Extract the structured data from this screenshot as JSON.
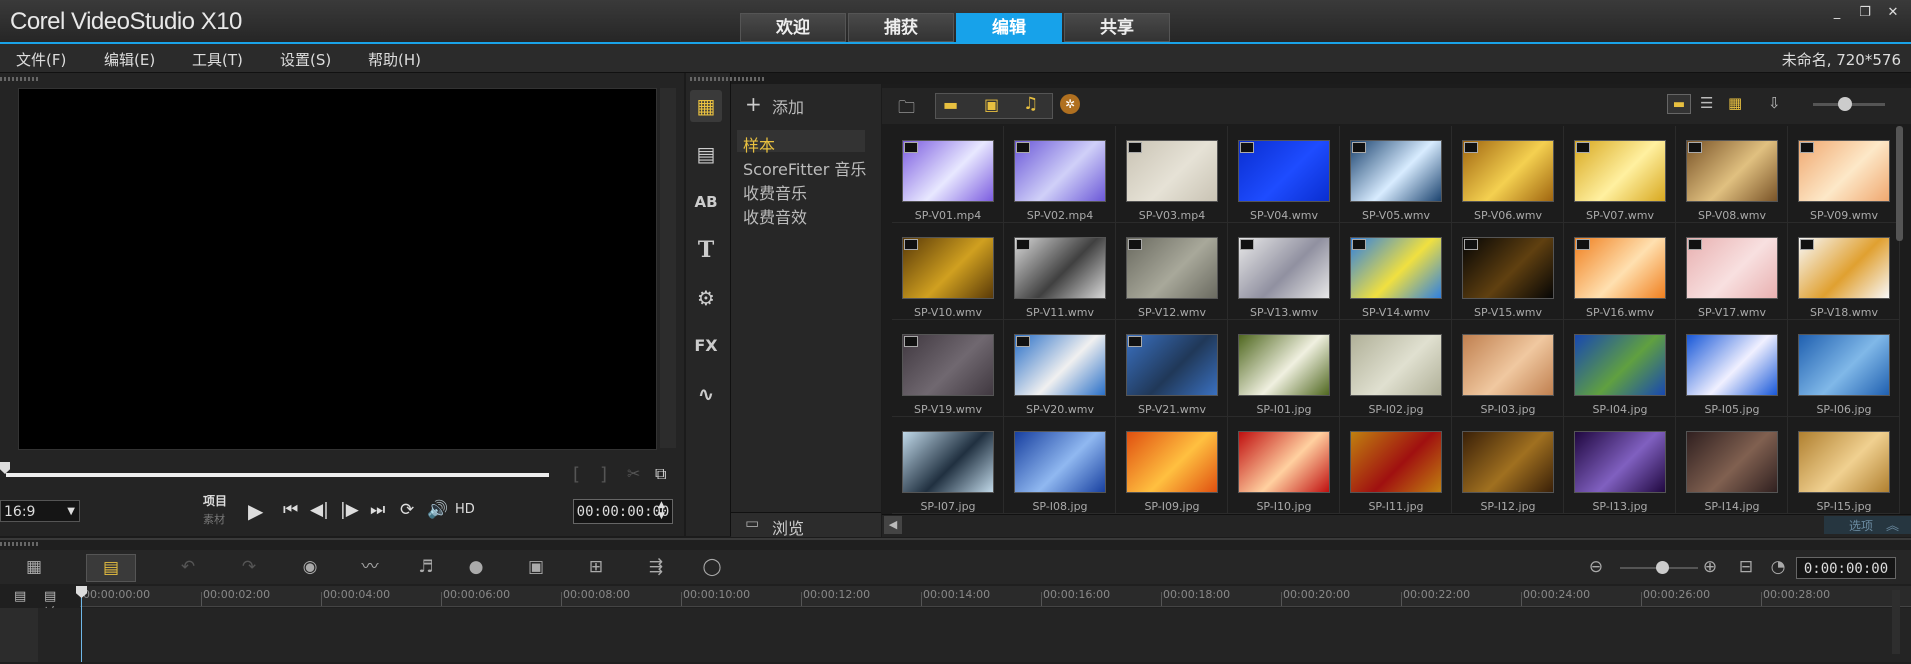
{
  "app": {
    "logo_text": "Corel VideoStudio X10"
  },
  "window_buttons": [
    "_",
    "❐",
    "✕"
  ],
  "tabs": [
    {
      "label": "欢迎",
      "active": false
    },
    {
      "label": "捕获",
      "active": false
    },
    {
      "label": "编辑",
      "active": true
    },
    {
      "label": "共享",
      "active": false
    }
  ],
  "menu": [
    "文件(F)",
    "编辑(E)",
    "工具(T)",
    "设置(S)",
    "帮助(H)"
  ],
  "project_info": "未命名, 720*576",
  "player": {
    "aspect_ratio": "16:9",
    "mode_project": "项目",
    "mode_clip": "素材",
    "hd_label": "HD",
    "timecode": "00:00:00:00"
  },
  "library": {
    "add_label": "添加",
    "categories": [
      {
        "label": "样本",
        "selected": true
      },
      {
        "label": "ScoreFitter 音乐",
        "selected": false
      },
      {
        "label": "收费音乐",
        "selected": false
      },
      {
        "label": "收费音效",
        "selected": false
      }
    ],
    "browse_label": "浏览",
    "options_label": "选项",
    "clips": [
      {
        "name": "SP-V01.mp4",
        "video": true,
        "c1": "#7c5de0",
        "c2": "#e8e8ff"
      },
      {
        "name": "SP-V02.mp4",
        "video": true,
        "c1": "#6b58d8",
        "c2": "#d0d0f8"
      },
      {
        "name": "SP-V03.mp4",
        "video": true,
        "c1": "#c9c3b4",
        "c2": "#e6e2d6"
      },
      {
        "name": "SP-V04.wmv",
        "video": true,
        "c1": "#0a2ed0",
        "c2": "#1e4cff"
      },
      {
        "name": "SP-V05.wmv",
        "video": true,
        "c1": "#1c4470",
        "c2": "#d8ecff"
      },
      {
        "name": "SP-V06.wmv",
        "video": true,
        "c1": "#a06610",
        "c2": "#f4d050"
      },
      {
        "name": "SP-V07.wmv",
        "video": true,
        "c1": "#d8a820",
        "c2": "#fff0a0"
      },
      {
        "name": "SP-V08.wmv",
        "video": true,
        "c1": "#7a5428",
        "c2": "#e0c080"
      },
      {
        "name": "SP-V09.wmv",
        "video": true,
        "c1": "#f0a870",
        "c2": "#fde8c8"
      },
      {
        "name": "SP-V10.wmv",
        "video": true,
        "c1": "#5a3a08",
        "c2": "#d0a020"
      },
      {
        "name": "SP-V11.wmv",
        "video": true,
        "c1": "#d8d8d8",
        "c2": "#404040"
      },
      {
        "name": "SP-V12.wmv",
        "video": true,
        "c1": "#6a6a60",
        "c2": "#a8a89a"
      },
      {
        "name": "SP-V13.wmv",
        "video": true,
        "c1": "#e8e8e8",
        "c2": "#9090a0"
      },
      {
        "name": "SP-V14.wmv",
        "video": true,
        "c1": "#3080e0",
        "c2": "#f0e040"
      },
      {
        "name": "SP-V15.wmv",
        "video": true,
        "c1": "#050505",
        "c2": "#604010"
      },
      {
        "name": "SP-V16.wmv",
        "video": true,
        "c1": "#f08020",
        "c2": "#ffe0b0"
      },
      {
        "name": "SP-V17.wmv",
        "video": true,
        "c1": "#e8b0b0",
        "c2": "#f8e0e0"
      },
      {
        "name": "SP-V18.wmv",
        "video": true,
        "c1": "#f8f8f8",
        "c2": "#e0a030"
      },
      {
        "name": "SP-V19.wmv",
        "video": true,
        "c1": "#403840",
        "c2": "#706870"
      },
      {
        "name": "SP-V20.wmv",
        "video": true,
        "c1": "#2a70c8",
        "c2": "#f0f0f0"
      },
      {
        "name": "SP-V21.wmv",
        "video": true,
        "c1": "#3a70c0",
        "c2": "#203858"
      },
      {
        "name": "SP-I01.jpg",
        "video": false,
        "c1": "#506820",
        "c2": "#f0f0e0"
      },
      {
        "name": "SP-I02.jpg",
        "video": false,
        "c1": "#b0b098",
        "c2": "#e0e0d0"
      },
      {
        "name": "SP-I03.jpg",
        "video": false,
        "c1": "#c08050",
        "c2": "#f0c8a0"
      },
      {
        "name": "SP-I04.jpg",
        "video": false,
        "c1": "#1848b0",
        "c2": "#60a040"
      },
      {
        "name": "SP-I05.jpg",
        "video": false,
        "c1": "#1858d8",
        "c2": "#f0f0ff"
      },
      {
        "name": "SP-I06.jpg",
        "video": false,
        "c1": "#2060b0",
        "c2": "#80b8e8"
      },
      {
        "name": "SP-I07.jpg",
        "video": false,
        "c1": "#c0d8e8",
        "c2": "#203040"
      },
      {
        "name": "SP-I08.jpg",
        "video": false,
        "c1": "#1840a0",
        "c2": "#90b8f0"
      },
      {
        "name": "SP-I09.jpg",
        "video": false,
        "c1": "#e05010",
        "c2": "#ffc040"
      },
      {
        "name": "SP-I10.jpg",
        "video": false,
        "c1": "#c01010",
        "c2": "#ffd0a0"
      },
      {
        "name": "SP-I11.jpg",
        "video": false,
        "c1": "#c08010",
        "c2": "#a01010"
      },
      {
        "name": "SP-I12.jpg",
        "video": false,
        "c1": "#3a2008",
        "c2": "#a07020"
      },
      {
        "name": "SP-I13.jpg",
        "video": false,
        "c1": "#200840",
        "c2": "#8060c0"
      },
      {
        "name": "SP-I14.jpg",
        "video": false,
        "c1": "#302020",
        "c2": "#806050"
      },
      {
        "name": "SP-I15.jpg",
        "video": false,
        "c1": "#b08030",
        "c2": "#f0d090"
      }
    ]
  },
  "timeline": {
    "timecode": "0:00:00:00",
    "ruler": [
      "00:00:00:00",
      "00:00:02:00",
      "00:00:04:00",
      "00:00:06:00",
      "00:00:08:00",
      "00:00:10:00",
      "00:00:12:00",
      "00:00:14:00",
      "00:00:16:00",
      "00:00:18:00",
      "00:00:20:00",
      "00:00:22:00",
      "00:00:24:00",
      "00:00:26:00",
      "00:00:28:00"
    ],
    "add_remove": "+/-"
  },
  "colors": {
    "accent": "#17a2ea",
    "highlight": "#e8c040"
  }
}
